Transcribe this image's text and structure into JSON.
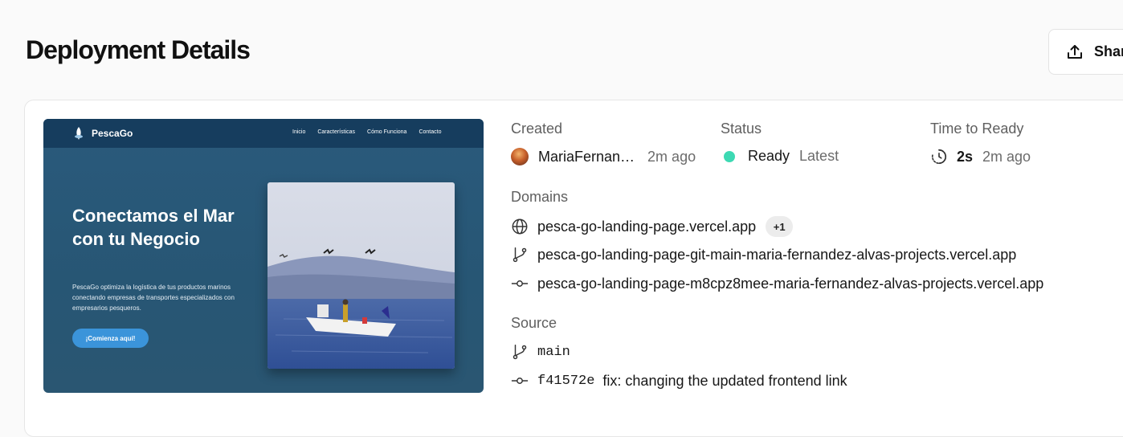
{
  "page": {
    "title": "Deployment Details"
  },
  "toolbar": {
    "share_label": "Share"
  },
  "preview": {
    "logo": "PescaGo",
    "nav": [
      "Inicio",
      "Características",
      "Cómo Funciona",
      "Contacto"
    ],
    "hero_title": "Conectamos el Mar con tu Negocio",
    "hero_text": "PescaGo optimiza la logística de tus productos marinos conectando empresas de transportes especializados con empresarios pesqueros.",
    "cta": "¡Comienza aquí!"
  },
  "created": {
    "label": "Created",
    "user": "MariaFernan…",
    "time": "2m ago"
  },
  "status": {
    "label": "Status",
    "value": "Ready",
    "tag": "Latest",
    "color": "#3dd9b3"
  },
  "time_to_ready": {
    "label": "Time to Ready",
    "value": "2s",
    "time": "2m ago"
  },
  "domains": {
    "label": "Domains",
    "items": [
      {
        "icon": "globe-icon",
        "url": "pesca-go-landing-page.vercel.app",
        "badge": "+1"
      },
      {
        "icon": "git-branch-icon",
        "url": "pesca-go-landing-page-git-main-maria-fernandez-alvas-projects.vercel.app"
      },
      {
        "icon": "git-commit-icon",
        "url": "pesca-go-landing-page-m8cpz8mee-maria-fernandez-alvas-projects.vercel.app"
      }
    ]
  },
  "source": {
    "label": "Source",
    "branch": "main",
    "commit_hash": "f41572e",
    "commit_message": "fix: changing the updated frontend link"
  }
}
